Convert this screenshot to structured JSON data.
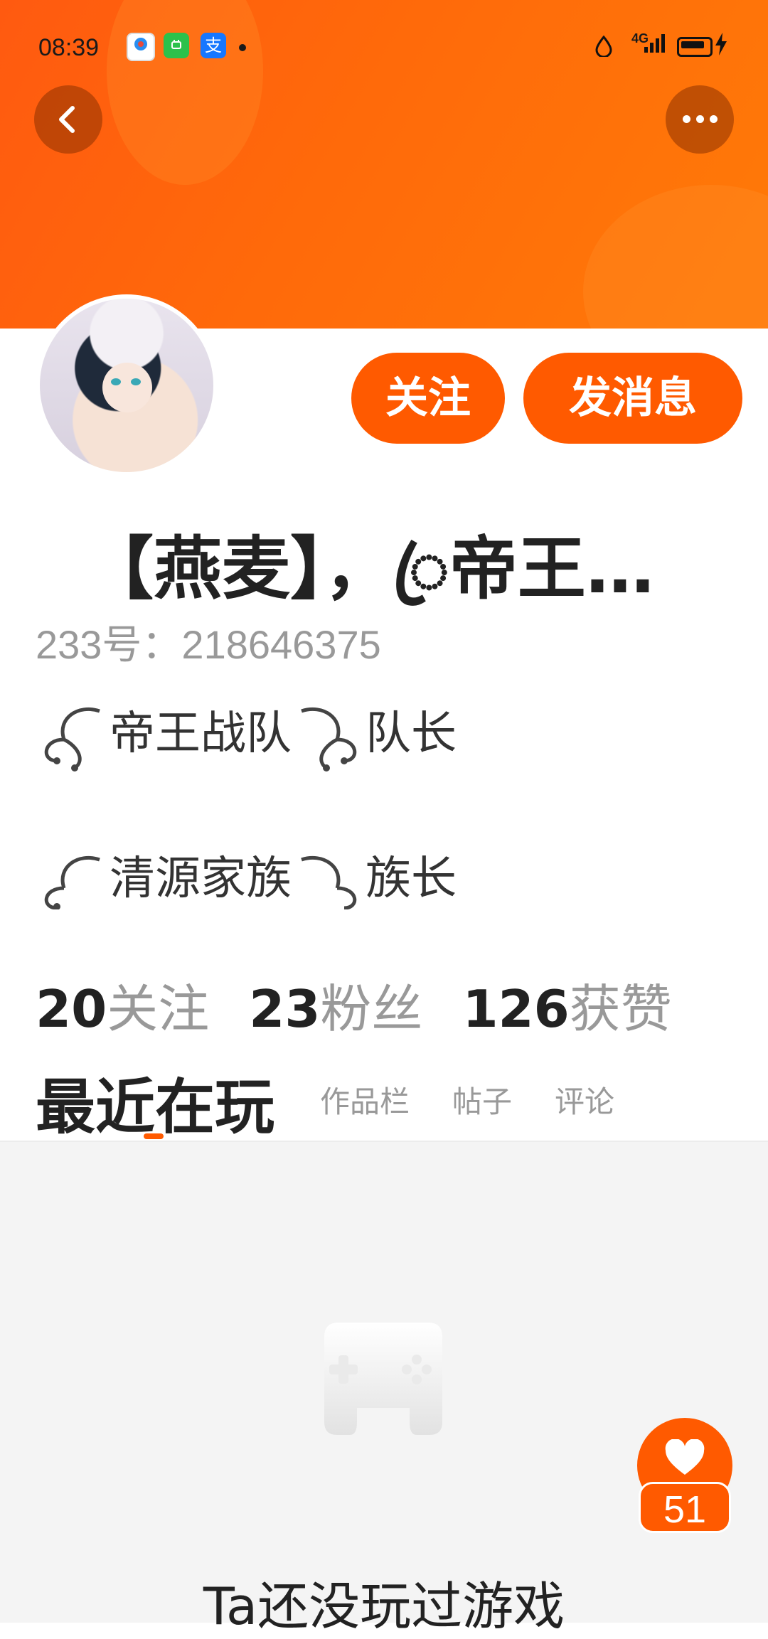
{
  "status_bar": {
    "time": "08:39",
    "network": "4G",
    "notif_icons": [
      "app-icon-1",
      "wechat-icon",
      "alipay-icon"
    ],
    "alipay_glyph": "支"
  },
  "header": {
    "back_icon": "chevron-left-icon",
    "more_icon": "more-icon"
  },
  "profile": {
    "name": "【燕麦】，ꦿ帝王…",
    "id_text": "233号：218646375",
    "follow_label": "关注",
    "message_label": "发消息",
    "tagline_1": {
      "left": "帝王战队",
      "right": "队长"
    },
    "tagline_2": {
      "left": "清源家族",
      "right": "族长"
    }
  },
  "stats": [
    {
      "value": "20",
      "label": "关注"
    },
    {
      "value": "23",
      "label": "粉丝"
    },
    {
      "value": "126",
      "label": "获赞"
    }
  ],
  "tabs": {
    "active": "最近在玩",
    "items": [
      "作品栏",
      "帖子",
      "评论"
    ]
  },
  "empty_state": {
    "icon": "gamepad-icon",
    "text": "Ta还没玩过游戏"
  },
  "like_fab": {
    "count": "51"
  },
  "colors": {
    "accent": "#ff5a00",
    "muted_text": "#999999",
    "content_bg": "#f4f4f4"
  }
}
